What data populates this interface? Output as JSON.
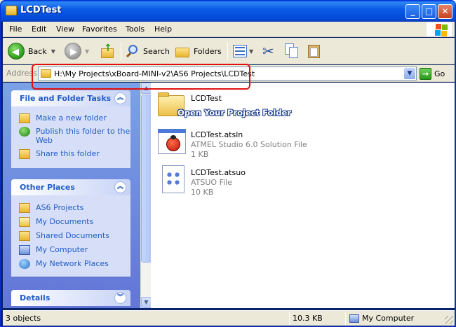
{
  "window": {
    "title": "LCDTest"
  },
  "menu": [
    "File",
    "Edit",
    "View",
    "Favorites",
    "Tools",
    "Help"
  ],
  "toolbar": {
    "back_label": "Back",
    "search_label": "Search",
    "folders_label": "Folders"
  },
  "address": {
    "label": "Address",
    "path": "H:\\My Projects\\xBoard-MINI-v2\\AS6 Projects\\LCDTest",
    "go_label": "Go"
  },
  "tasks_panel": {
    "title": "File and Folder Tasks",
    "items": [
      {
        "label": "Make a new folder",
        "icon": "new-folder-icon"
      },
      {
        "label": "Publish this folder to the Web",
        "icon": "publish-web-icon"
      },
      {
        "label": "Share this folder",
        "icon": "share-folder-icon"
      }
    ]
  },
  "places_panel": {
    "title": "Other Places",
    "items": [
      {
        "label": "AS6 Projects",
        "icon": "folder-icon"
      },
      {
        "label": "My Documents",
        "icon": "my-documents-icon"
      },
      {
        "label": "Shared Documents",
        "icon": "shared-documents-icon"
      },
      {
        "label": "My Computer",
        "icon": "my-computer-icon"
      },
      {
        "label": "My Network Places",
        "icon": "network-places-icon"
      }
    ]
  },
  "details_panel": {
    "title": "Details"
  },
  "files": [
    {
      "name": "LCDTest",
      "type": "",
      "size": "",
      "icon": "folder-icon"
    },
    {
      "name": "LCDTest.atsln",
      "type": "ATMEL Studio 6.0 Solution File",
      "size": "1 KB",
      "icon": "atmel-ladybug-icon"
    },
    {
      "name": "LCDTest.atsuo",
      "type": "ATSUO File",
      "size": "10 KB",
      "icon": "generic-file-icon"
    }
  ],
  "overlay_text": "Open Your Project Folder",
  "status": {
    "objects": "3 objects",
    "size": "10.3 KB",
    "location": "My Computer"
  },
  "colors": {
    "titlebar": "#0b5be6",
    "link": "#215dc6",
    "highlight": "#e01010"
  }
}
